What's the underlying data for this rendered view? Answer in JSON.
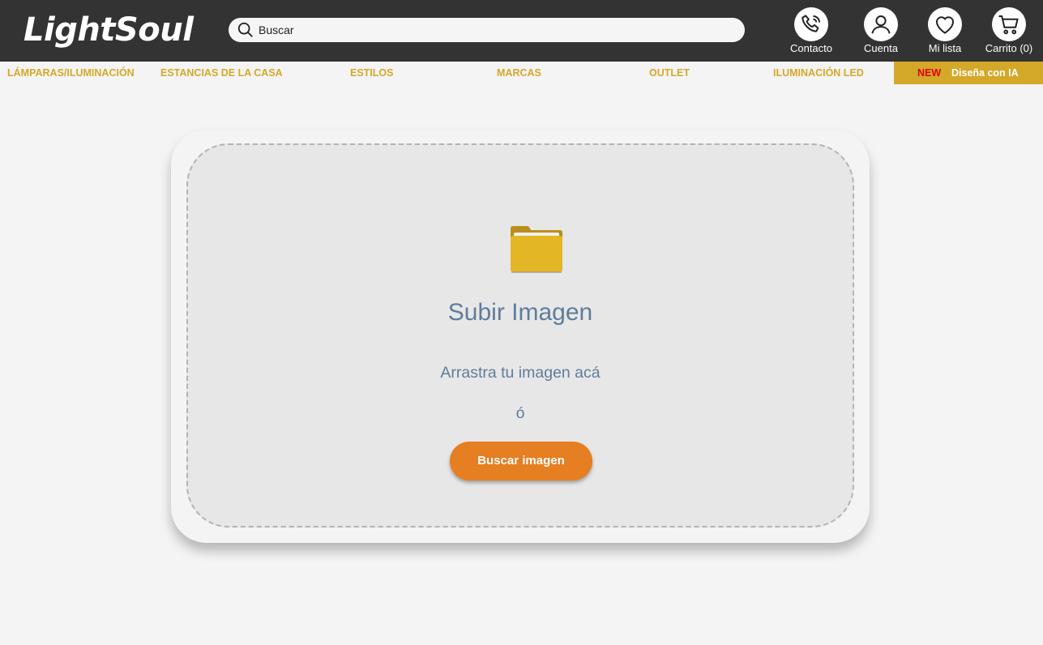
{
  "brand": {
    "name": "LightSoul"
  },
  "search": {
    "placeholder": "Buscar"
  },
  "header_actions": [
    {
      "label": "Contacto",
      "icon": "phone-icon"
    },
    {
      "label": "Cuenta",
      "icon": "user-icon"
    },
    {
      "label": "Mi lista",
      "icon": "heart-icon"
    },
    {
      "label": "Carrito (0)",
      "icon": "cart-icon"
    }
  ],
  "nav": {
    "items": [
      "LÁMPARAS/ILUMINACIÓN",
      "ESTANCIAS DE LA CASA",
      "ESTILOS",
      "MARCAS",
      "OUTLET",
      "ILUMINACIÓN LED"
    ],
    "ia_badge": "NEW",
    "ia_label": "Diseña con IA"
  },
  "upload": {
    "icon": "folder-icon",
    "title": "Subir Imagen",
    "subtitle": "Arrastra tu imagen acá",
    "or": "ó",
    "button": "Buscar imagen"
  },
  "colors": {
    "header_bg": "#333333",
    "accent_gold": "#d4a829",
    "new_red": "#e20000",
    "button_orange": "#e67e22",
    "text_blue": "#5f7d9b"
  }
}
